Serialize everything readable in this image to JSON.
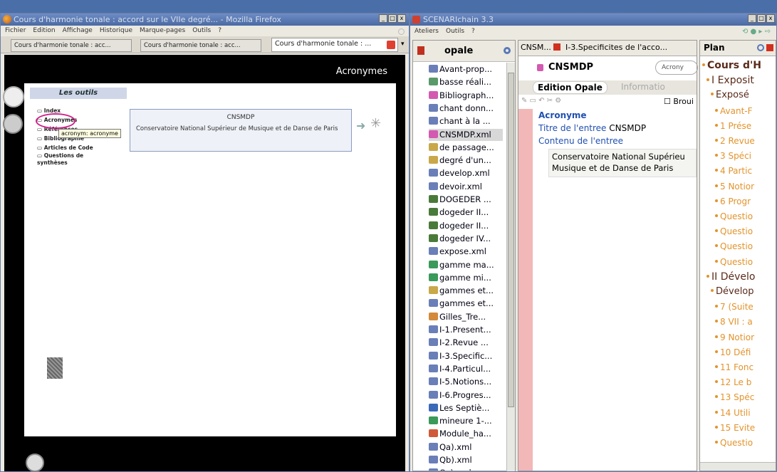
{
  "firefox": {
    "title": "Cours d'harmonie tonale : accord sur le VIIe degré... - Mozilla Firefox",
    "menu": [
      "Fichier",
      "Edition",
      "Affichage",
      "Historique",
      "Marque-pages",
      "Outils",
      "?"
    ],
    "tabs": [
      "Cours d'harmonie tonale : acc...",
      "Cours d'harmonie tonale : acc...",
      "Cours d'harmonie tonale : ..."
    ],
    "header_title": "Acronymes",
    "tools_title": "Les outils",
    "tools": [
      "Index",
      "Acronymes",
      "Références",
      "Bibliographie",
      "Articles de Code",
      "Questions de synthèses"
    ],
    "tooltip": "acronym: acronyme",
    "acronym_title": "CNSMDP",
    "acronym_text": "Conservatoire National Supérieur de Musique et de Danse de Paris"
  },
  "scenari": {
    "title": "SCENARIchain 3.3",
    "menu": [
      "Ateliers",
      "Outils",
      "?"
    ],
    "workspace": "opale",
    "tree": [
      "Avant-prop...",
      "basse réali...",
      "Bibliograph...",
      "chant donn...",
      "chant à la ...",
      "CNSMDP.xml",
      "de passage...",
      "degré d'un...",
      "develop.xml",
      "devoir.xml",
      "DOGEDER ...",
      "dogeder II...",
      "dogeder II...",
      "dogeder IV...",
      "expose.xml",
      "gamme ma...",
      "gamme mi...",
      "gammes et...",
      "gammes et...",
      "Gilles_Tre...",
      "I-1.Present...",
      "I-2.Revue ...",
      "I-3.Specific...",
      "I-4.Particul...",
      "I-5.Notions...",
      "I-6.Progres...",
      "Les Septiè...",
      "mineure 1-...",
      "Module_ha...",
      "Qa).xml",
      "Qb).xml",
      "Qc).xml"
    ],
    "editor_tabs": [
      "CNSM...",
      "I-3.Specificites de l'acco..."
    ],
    "doc_title": "CNSMDP",
    "doc_type": "Acrony",
    "edit_tab": "Edition Opale",
    "info_tab": "Informatio",
    "brouillon": "Broui",
    "section": "Acronyme",
    "field_title_label": "Titre de l'entree",
    "field_title_value": "CNSMDP",
    "field_content_label": "Contenu de l'entree",
    "field_content_value": "Conservatoire National Supérieu Musique et de Danse de Paris",
    "plan_title": "Plan",
    "plan_items": [
      {
        "text": "Cours d'H",
        "level": 0
      },
      {
        "text": "I Exposit",
        "level": 1
      },
      {
        "text": "Exposé",
        "level": 2
      },
      {
        "text": "Avant-F",
        "level": 3
      },
      {
        "text": "1 Prése",
        "level": 3
      },
      {
        "text": "2 Revue",
        "level": 3
      },
      {
        "text": "3 Spéci",
        "level": 3
      },
      {
        "text": "4 Partic",
        "level": 3
      },
      {
        "text": "5 Notior",
        "level": 3
      },
      {
        "text": "6 Progr",
        "level": 3
      },
      {
        "text": "Questio",
        "level": 3
      },
      {
        "text": "Questio",
        "level": 3
      },
      {
        "text": "Questio",
        "level": 3
      },
      {
        "text": "Questio",
        "level": 3
      },
      {
        "text": "II Dévelo",
        "level": 1
      },
      {
        "text": "Dévelop",
        "level": 2
      },
      {
        "text": "7 (Suite",
        "level": 3
      },
      {
        "text": "8 VII : a",
        "level": 3
      },
      {
        "text": "9 Notior",
        "level": 3
      },
      {
        "text": "10 Défi",
        "level": 3
      },
      {
        "text": "11 Fonc",
        "level": 3
      },
      {
        "text": "12 Le b",
        "level": 3
      },
      {
        "text": "13 Spéc",
        "level": 3
      },
      {
        "text": "14 Utili",
        "level": 3
      },
      {
        "text": "15 Evite",
        "level": 3
      },
      {
        "text": "Questio",
        "level": 3
      }
    ]
  }
}
